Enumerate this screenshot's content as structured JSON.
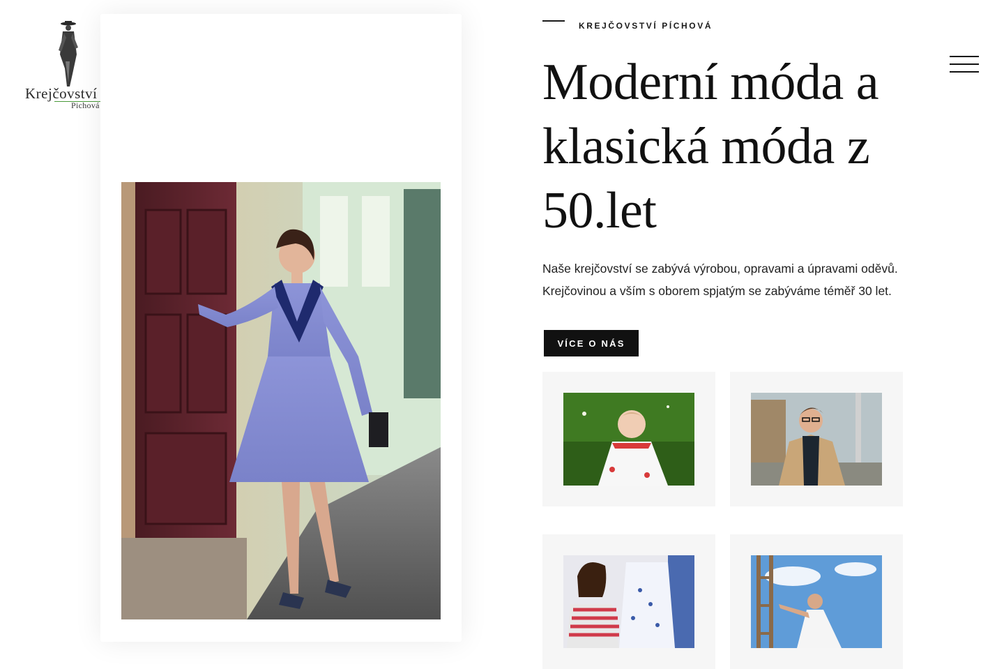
{
  "brand": {
    "name": "Krejčovství",
    "subname": "Pichová"
  },
  "hero": {
    "eyebrow": "KREJČOVSTVÍ PÍCHOVÁ",
    "title": "Moderní móda a klasická móda z 50.let",
    "intro": "Naše krejčovství se zabývá výrobou, opravami a úpravami oděvů. Krejčovinou a vším s oborem spjatým se zabýváme téměř 30 let.",
    "button_label": "VÍCE O NÁS"
  },
  "menu": {
    "icon": "hamburger-menu-icon"
  },
  "images": {
    "main": "woman-in-blue-1950s-dress-photo",
    "tiles": [
      "baby-in-white-dress-photo",
      "man-in-beige-coat-photo",
      "woman-with-dresses-photo",
      "woman-on-ladder-photo"
    ]
  },
  "colors": {
    "accent": "#111111",
    "logo_green": "#4a9a3a",
    "tile_bg": "#f6f6f6"
  }
}
